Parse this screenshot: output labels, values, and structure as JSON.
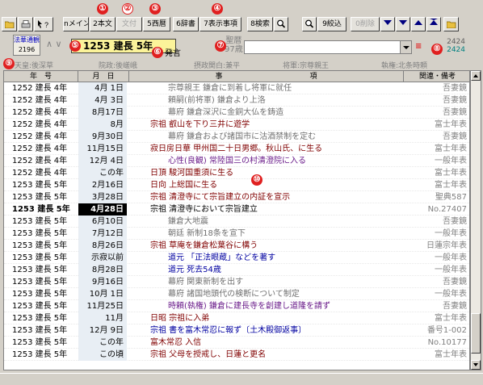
{
  "markers": [
    "①",
    "②",
    "③",
    "④",
    "⑤",
    "⑥",
    "⑦",
    "⑧",
    "⑨",
    "⑩"
  ],
  "toolbar": {
    "main_label": "nメイン",
    "honbun_label": "2本文",
    "btn3_label": "文付",
    "seireki_label": "5西暦",
    "jisho_label": "6辞書",
    "hyoji_label": "7表示事項",
    "search_label": "8検索",
    "narrow_label": "9絞込",
    "delete_label": "0削除"
  },
  "info": {
    "category_title": "法華通観",
    "category_count": "2196",
    "arrows": "∧ ∨",
    "current_date": "1253 建長 5年",
    "hatsu": "発言",
    "era_top": "聖暦",
    "era_bottom": "97歳",
    "count_total": "2424",
    "count_filtered": "2424",
    "emperor": "天皇:後深草",
    "retired": "院政:後嵯峨",
    "regent": "摂政関白:兼平",
    "shogun": "将軍:宗尊親王",
    "shikken": "執権:北条時頼"
  },
  "table": {
    "headers": [
      "年　号",
      "月　日",
      "事　　　　　　　　　　　　項",
      "関連・備考"
    ],
    "rows": [
      {
        "year": "1252 建長 4年",
        "date": "4月 1日",
        "event": "宗尊親王 鎌倉に到着し将軍に就任",
        "ref": "吾妻鏡",
        "color": "g",
        "indent": 1
      },
      {
        "year": "1252 建長 4年",
        "date": "4月 3日",
        "event": "頼嗣(前将軍) 鎌倉より上洛",
        "ref": "吾妻鏡",
        "color": "g",
        "indent": 1
      },
      {
        "year": "1252 建長 4年",
        "date": "8月17日",
        "event": "幕府 鎌倉深沢に金銅大仏を鋳造",
        "ref": "吾妻鏡",
        "color": "g",
        "indent": 1
      },
      {
        "year": "1252 建長 4年",
        "date": "8月",
        "event": "宗祖 叡山を下り三井に遊学",
        "ref": "富士年表",
        "color": "p",
        "indent": 0
      },
      {
        "year": "1252 建長 4年",
        "date": "9月30日",
        "event": "幕府 鎌倉および諸国市に沽酒禁制を定む",
        "ref": "吾妻鏡",
        "color": "g",
        "indent": 1
      },
      {
        "year": "1252 建長 4年",
        "date": "11月15日",
        "event": "寂日房日華 甲州国二十日男郷。秋山氏、に生る",
        "ref": "富士年表",
        "color": "p",
        "indent": 0
      },
      {
        "year": "1252 建長 4年",
        "date": "12月 4日",
        "event": "心性(良観) 常陸国三の村清澄院に入る",
        "ref": "一般年表",
        "color": "pu",
        "indent": 1
      },
      {
        "year": "1252 建長 4年",
        "date": "この年",
        "event": "日頂 駿河国重須に生る",
        "ref": "富士年表",
        "color": "p",
        "indent": 0
      },
      {
        "year": "1253 建長 5年",
        "date": "2月16日",
        "event": "日向 上総国に生る",
        "ref": "富士年表",
        "color": "p",
        "indent": 0
      },
      {
        "year": "1253 建長 5年",
        "date": "3月28日",
        "event": "宗祖 清澄寺にて宗旨建立の内証を宣示",
        "ref": "聖典587",
        "color": "p",
        "indent": 0
      },
      {
        "year": "1253 建長 5年",
        "date": "4月28日",
        "event": "宗祖 清澄寺において宗旨建立",
        "ref": "No.27407",
        "color": "k",
        "indent": 0,
        "selected": true
      },
      {
        "year": "1253 建長 5年",
        "date": "6月10日",
        "event": "鎌倉大地震",
        "ref": "吾妻鏡",
        "color": "g",
        "indent": 1
      },
      {
        "year": "1253 建長 5年",
        "date": "7月12日",
        "event": "朝廷 新制18条を宣下",
        "ref": "一般年表",
        "color": "g",
        "indent": 1
      },
      {
        "year": "1253 建長 5年",
        "date": "8月26日",
        "event": "宗祖 草庵を鎌倉松葉谷に構う",
        "ref": "日蓮宗年表",
        "color": "p",
        "indent": 0
      },
      {
        "year": "1253 建長 5年",
        "date": "示寂以前",
        "event": "道元 「正法眼蔵」などを著す",
        "ref": "一般年表",
        "color": "b",
        "indent": 1
      },
      {
        "year": "1253 建長 5年",
        "date": "8月28日",
        "event": "道元 死去54歳",
        "ref": "一般年表",
        "color": "b",
        "indent": 1
      },
      {
        "year": "1253 建長 5年",
        "date": "9月16日",
        "event": "幕府 関東新制を出す",
        "ref": "吾妻鏡",
        "color": "g",
        "indent": 1
      },
      {
        "year": "1253 建長 5年",
        "date": "10月 1日",
        "event": "幕府 諸国地頭代の検断について制定",
        "ref": "一般年表",
        "color": "g",
        "indent": 1
      },
      {
        "year": "1253 建長 5年",
        "date": "11月25日",
        "event": "時頼(執権) 鎌倉に建長寺を創建し道隆を請ず",
        "ref": "吾妻鏡",
        "color": "pu",
        "indent": 1
      },
      {
        "year": "1253 建長 5年",
        "date": "11月",
        "event": "日昭 宗祖に入弟",
        "ref": "富士年表",
        "color": "p",
        "indent": 0
      },
      {
        "year": "1253 建長 5年",
        "date": "12月 9日",
        "event": "宗祖 書を富木常忍に報ず〔土木殿御返事〕",
        "ref": "番号1-002",
        "color": "b",
        "indent": 0
      },
      {
        "year": "1253 建長 5年",
        "date": "この年",
        "event": "富木常忍 入信",
        "ref": "No.10177",
        "color": "p",
        "indent": 0
      },
      {
        "year": "1253 建長 5年",
        "date": "この頃",
        "event": "宗祖 父母を授戒し、日蓮と更名",
        "ref": "富士年表",
        "color": "p",
        "indent": 0
      }
    ]
  },
  "colors": {
    "selected_bg": "#000000",
    "date_col_bg": "#e8eef4",
    "marker": "#e02020",
    "current_date_bg": "#fbf39a"
  }
}
